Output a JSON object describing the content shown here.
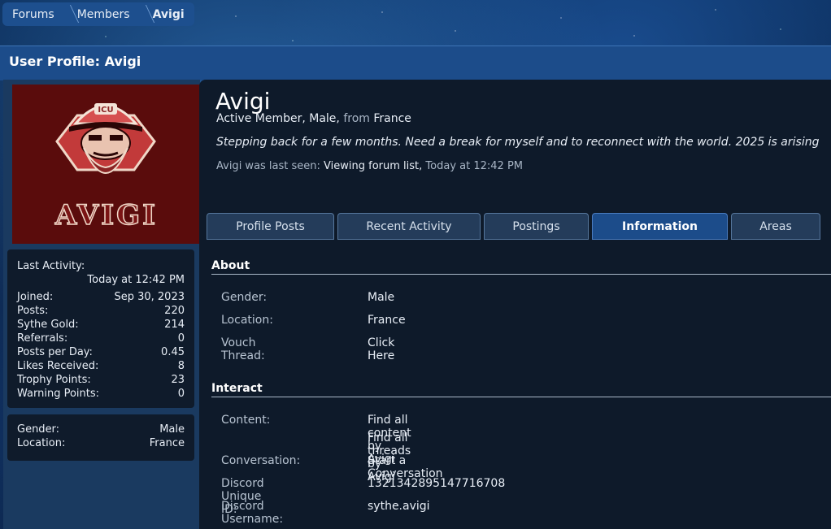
{
  "breadcrumb": {
    "items": [
      "Forums",
      "Members",
      "Avigi"
    ]
  },
  "page_title": "User Profile: Avigi",
  "avatar": {
    "text": "AVIGI",
    "cap_text": "ICU"
  },
  "sidebar": {
    "stats": {
      "last_activity_label": "Last Activity:",
      "last_activity_value": "Today at 12:42 PM",
      "rows": [
        {
          "label": "Joined:",
          "value": "Sep 30, 2023"
        },
        {
          "label": "Posts:",
          "value": "220"
        },
        {
          "label": "Sythe Gold:",
          "value": "214"
        },
        {
          "label": "Referrals:",
          "value": "0"
        },
        {
          "label": "Posts per Day:",
          "value": "0.45"
        },
        {
          "label": "Likes Received:",
          "value": "8"
        },
        {
          "label": "Trophy Points:",
          "value": "23"
        },
        {
          "label": "Warning Points:",
          "value": "0"
        }
      ]
    },
    "info": [
      {
        "label": "Gender:",
        "value": "Male"
      },
      {
        "label": "Location:",
        "value": "France"
      }
    ]
  },
  "profile": {
    "username": "Avigi",
    "rank": "Active Member, Male,",
    "from_word": "from",
    "location": "France",
    "status": "Stepping back for a few months. Need a break for myself and to reconnect with the world. 2025 is arising",
    "last_seen_prefix": "Avigi was last seen:",
    "last_seen_activity": "Viewing forum list,",
    "last_seen_time": "Today at 12:42 PM"
  },
  "tabs": [
    "Profile Posts",
    "Recent Activity",
    "Postings",
    "Information",
    "Areas"
  ],
  "active_tab": "Information",
  "about": {
    "heading": "About",
    "rows": [
      {
        "label": "Gender:",
        "value": "Male"
      },
      {
        "label": "Location:",
        "value": "France"
      },
      {
        "label": "Vouch Thread:",
        "value": "Click Here"
      }
    ]
  },
  "interact": {
    "heading": "Interact",
    "content_label": "Content:",
    "content_links": [
      "Find all content by Avigi",
      "Find all threads by Avigi"
    ],
    "rows": [
      {
        "label": "Conversation:",
        "value": "Start a Conversation"
      },
      {
        "label": "Discord Unique ID:",
        "value": "1321342895147716708"
      },
      {
        "label": "Discord Username:",
        "value": "sythe.avigi"
      }
    ]
  },
  "colors": {
    "accent": "#1c4c8a",
    "panel": "#0e1a2a",
    "avatar_bg": "#5a0c0c"
  }
}
